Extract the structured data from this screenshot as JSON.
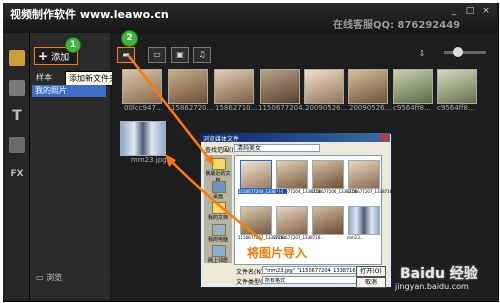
{
  "app": {
    "title": "视频制作软件 www.leawo.cn",
    "service": "在线客服QQ: 876292449",
    "window_buttons": [
      "_",
      "□",
      "×"
    ]
  },
  "left_icons": [
    "media-icon",
    "edit-icon",
    "text-icon",
    "transition-icon",
    "fx-icon"
  ],
  "left_icon_labels": {
    "fx": "FX"
  },
  "sidebar": {
    "add_label": "添加",
    "tooltip": "添加新文件夹",
    "tree": [
      "样本",
      "我的照片"
    ],
    "browse_label": "浏览",
    "collapse_icon": "«"
  },
  "callouts": [
    "1",
    "2"
  ],
  "toolbar": {
    "buttons": [
      "folder-icon",
      "video-icon",
      "image-icon",
      "music-icon"
    ]
  },
  "thumbnails": [
    {
      "label": "00lcc947..."
    },
    {
      "label": "15862720..."
    },
    {
      "label": "15862710..."
    },
    {
      "label": "1150677204..."
    },
    {
      "label": "20090526..."
    },
    {
      "label": "20090526..."
    },
    {
      "label": "c9564ff8..."
    },
    {
      "label": "c9564ff8..."
    }
  ],
  "selected_thumb": {
    "label": "mm23.jpg"
  },
  "dialog": {
    "title": "浏览媒体文件",
    "look_in_label": "查找范围(I):",
    "look_in_value": "清纯美女",
    "places": [
      "我最近的文档",
      "桌面",
      "我的文档",
      "我的电脑",
      "网上邻居"
    ],
    "files": [
      {
        "name": "1150677204_1338716...",
        "selected": true
      },
      {
        "name": "1150677204_1338716...",
        "selected": false
      },
      {
        "name": "1150677206_1338718...",
        "selected": false
      },
      {
        "name": "1150677207_1338716...",
        "selected": false
      },
      {
        "name": "1150677207_1338716...",
        "selected": false
      },
      {
        "name": "1150677207_1338716...",
        "selected": false
      },
      {
        "name": "mm23...",
        "selected": false
      },
      {
        "name": "",
        "selected": false
      }
    ],
    "filename_label": "文件名(N):",
    "filename_value": "\"mm23.jpg\" \"1150677204_1338716803.jpg\"",
    "filetype_label": "文件类型(T):",
    "filetype_value": "所有格式",
    "open_button": "打开(O)",
    "cancel_button": "取消"
  },
  "annotation": "将图片导入",
  "watermark": {
    "brand": "Baidu 经验",
    "url": "jingyan.baidu.com"
  },
  "colors": {
    "accent_orange": "#ff7a00",
    "callout_green": "#3fb63f",
    "selection_blue": "#3e6fc8",
    "window_dark": "#1b1b1b"
  }
}
